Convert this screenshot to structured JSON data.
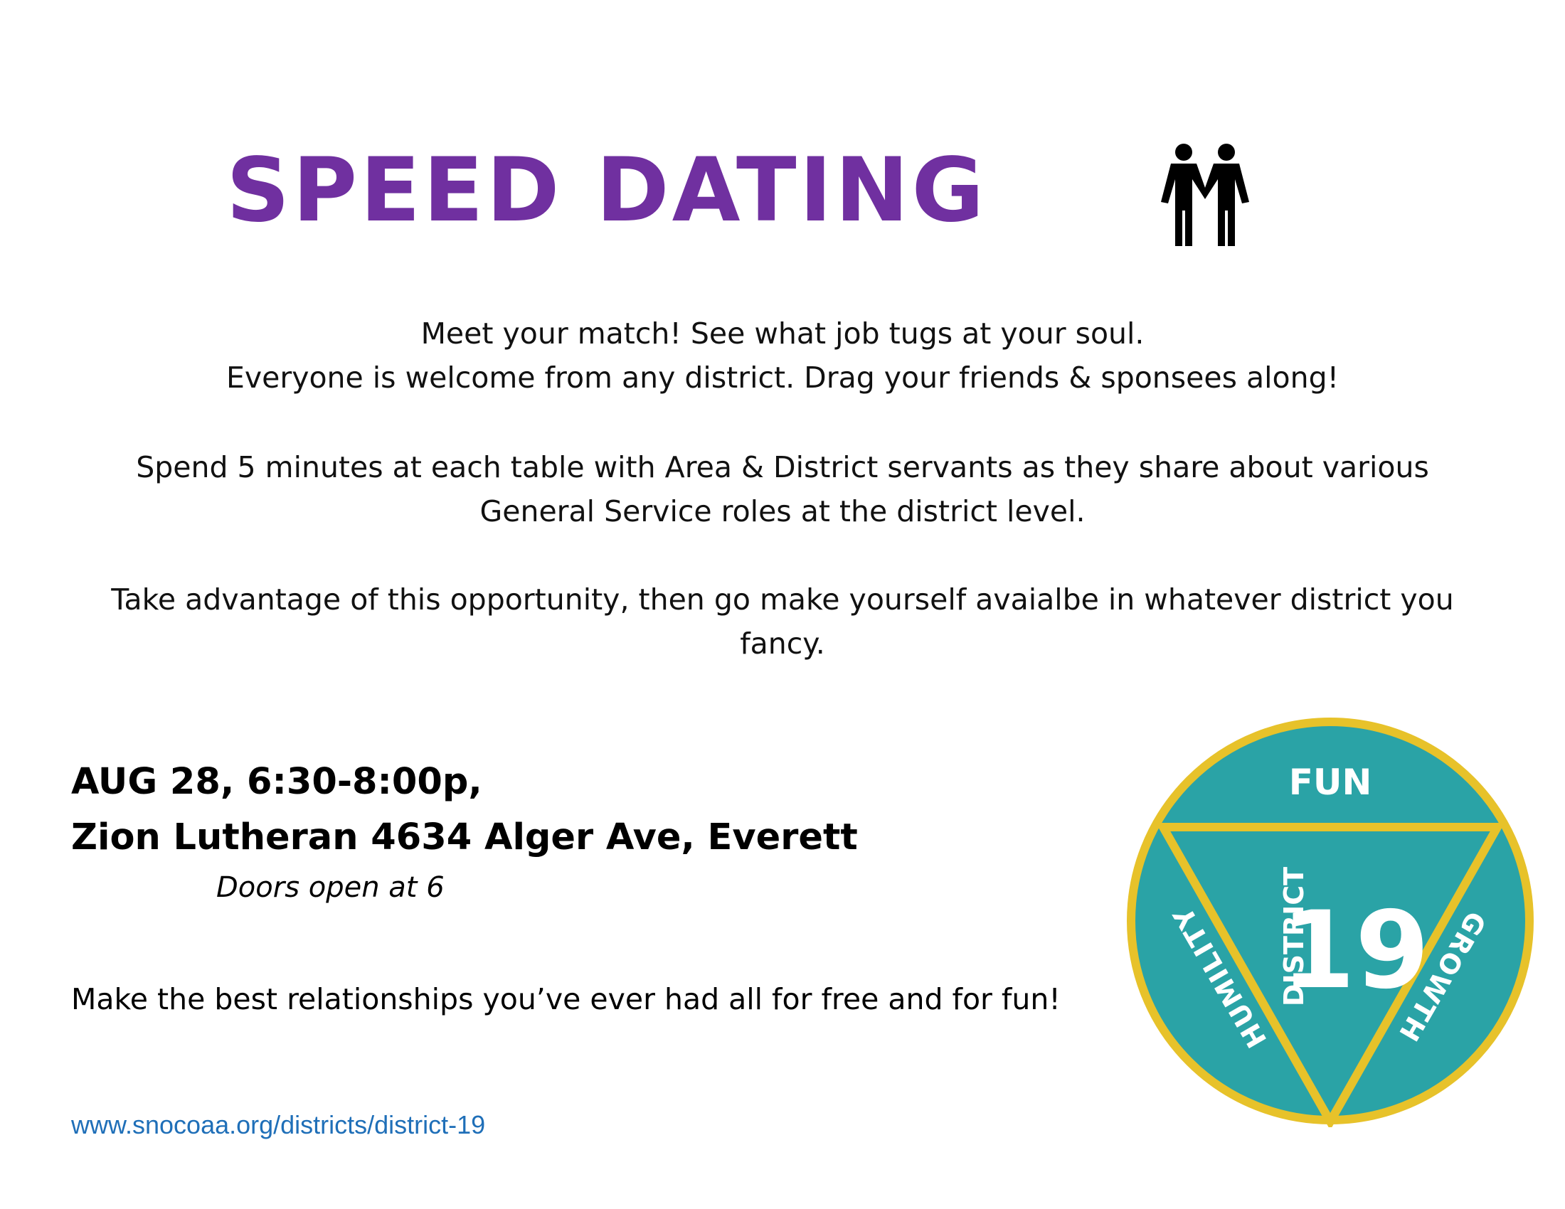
{
  "header": {
    "title": "SPEED DATING",
    "icon": "two-men-holding-hands-icon"
  },
  "intro": {
    "line1": "Meet your match! See what job tugs at your soul.",
    "line2": "Everyone is welcome from any district. Drag your friends & sponsees along!"
  },
  "details": {
    "spend_line1": "Spend 5 minutes at each table with Area & District servants as they share about various",
    "spend_line2": "General Service roles at the district level.",
    "take": "Take advantage of this opportunity, then go make yourself avaialbe in whatever district you fancy."
  },
  "event": {
    "date_time": "AUG 28, 6:30-8:00p,",
    "location": "Zion Lutheran 4634 Alger Ave, Everett",
    "doors": "Doors open at 6"
  },
  "tagline": "Make the best relationships you’ve ever had all for free and for fun!",
  "website": "www.snocoaa.org/districts/district-19",
  "logo": {
    "top_word": "FUN",
    "left_word": "HUMILITY",
    "right_word": "GROWTH",
    "district_word": "DISTRICT",
    "number": "19",
    "fill_color": "#2aa3a6",
    "ring_color": "#e7c22a"
  }
}
